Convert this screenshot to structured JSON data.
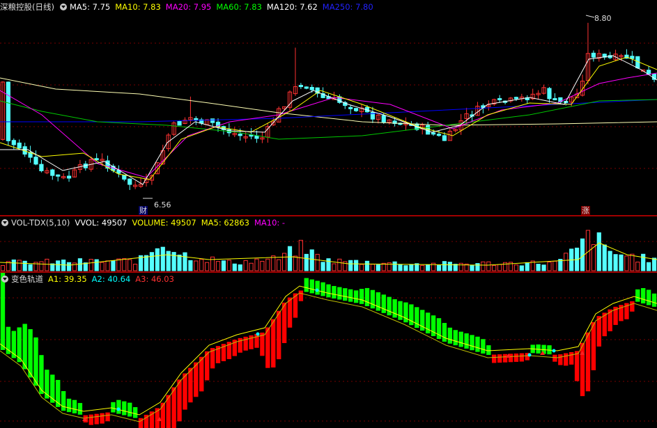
{
  "main_panel": {
    "stock_name": "深粮控股(日线)",
    "indicators": [
      {
        "label": "MA5: 7.75",
        "color": "#ffffff"
      },
      {
        "label": "MA10: 7.83",
        "color": "#ffff00"
      },
      {
        "label": "MA20: 7.95",
        "color": "#ff00ff"
      },
      {
        "label": "MA60: 7.83",
        "color": "#00ff00"
      },
      {
        "label": "MA120: 7.62",
        "color": "#ffffff"
      },
      {
        "label": "MA250: 7.80",
        "color": "#0000ff"
      }
    ],
    "high_label": "8.80",
    "low_label": "6.56",
    "badge_cai": "财",
    "badge_zhang": "涨"
  },
  "volume_panel": {
    "name": "VOL-TDX(5,10)",
    "indicators": [
      {
        "label": "VVOL: 49507",
        "color": "#ffffff"
      },
      {
        "label": "VOLUME: 49507",
        "color": "#ffff00"
      },
      {
        "label": "MA5: 62863",
        "color": "#ffff00"
      },
      {
        "label": "MA10: -",
        "color": "#ff00ff"
      }
    ]
  },
  "track_panel": {
    "name": "变色轨道",
    "indicators": [
      {
        "label": "A1: 39.35",
        "color": "#ffff00"
      },
      {
        "label": "A2: 40.64",
        "color": "#00ffff"
      },
      {
        "label": "A3: 46.03",
        "color": "#ff3030"
      }
    ]
  },
  "colors": {
    "up": "#ff3232",
    "down": "#54ffff",
    "grid": "#7a0000",
    "ma5": "#ffffff",
    "ma10": "#ffff00",
    "ma20": "#ff00ff",
    "ma60": "#00c800",
    "ma120": "#ffffb4",
    "ma250": "#0000ff",
    "track_up": "#ff0000",
    "track_down": "#00ff00"
  }
}
